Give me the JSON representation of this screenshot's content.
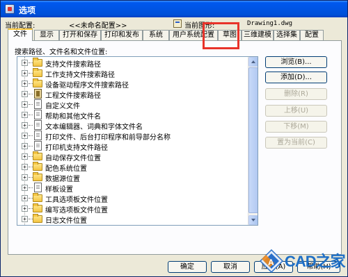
{
  "window": {
    "title": "选项"
  },
  "current": {
    "profile_label": "当前配置:",
    "profile_value": "<<未命名配置>>",
    "drawing_label": "当前图形:",
    "drawing_value": "Drawing1.dwg"
  },
  "tabs": [
    {
      "label": "文件",
      "active": true
    },
    {
      "label": "显示",
      "active": false
    },
    {
      "label": "打开和保存",
      "active": false
    },
    {
      "label": "打印和发布",
      "active": false
    },
    {
      "label": "系统",
      "active": false
    },
    {
      "label": "用户系统配置",
      "active": false
    },
    {
      "label": "草图",
      "active": false
    },
    {
      "label": "三维建模",
      "active": false
    },
    {
      "label": "选择集",
      "active": false
    },
    {
      "label": "配置",
      "active": false
    }
  ],
  "files_panel": {
    "search_label": "搜索路径、文件名和文件位置:",
    "tree": [
      {
        "label": "支持文件搜索路径",
        "icon": "folder-icon"
      },
      {
        "label": "工作支持文件搜索路径",
        "icon": "folder-icon"
      },
      {
        "label": "设备驱动程序文件搜索路径",
        "icon": "folder-icon"
      },
      {
        "label": "工程文件搜索路径",
        "icon": "book-icon"
      },
      {
        "label": "自定义文件",
        "icon": "document-icon"
      },
      {
        "label": "帮助和其他文件名",
        "icon": "document-icon"
      },
      {
        "label": "文本编辑器、词典和字体文件名",
        "icon": "document-icon"
      },
      {
        "label": "打印文件、后台打印程序和前导部分名称",
        "icon": "document-icon"
      },
      {
        "label": "打印机支持文件路径",
        "icon": "document-icon"
      },
      {
        "label": "自动保存文件位置",
        "icon": "folder-icon"
      },
      {
        "label": "配色系统位置",
        "icon": "folder-icon"
      },
      {
        "label": "数据源位置",
        "icon": "folder-icon"
      },
      {
        "label": "样板设置",
        "icon": "document-icon"
      },
      {
        "label": "工具选项板文件位置",
        "icon": "folder-icon"
      },
      {
        "label": "编写选项板文件位置",
        "icon": "folder-icon"
      },
      {
        "label": "日志文件位置",
        "icon": "folder-icon"
      }
    ],
    "buttons": {
      "browse": "浏览(B)...",
      "add": "添加(D)...",
      "remove": "删除(R)",
      "move_up": "上移(U)",
      "move_down": "下移(M)",
      "set_current": "置为当前(C)"
    }
  },
  "footer": {
    "ok": "确定",
    "cancel": "取消",
    "apply": "应用(A)",
    "help": "帮助(H)"
  },
  "watermark": {
    "text": "CAD之家"
  }
}
